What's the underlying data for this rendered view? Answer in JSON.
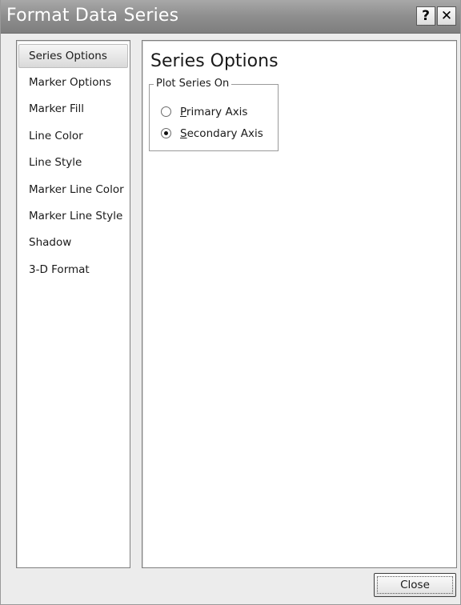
{
  "window": {
    "title": "Format Data Series",
    "help_label": "?",
    "close_label": "✕"
  },
  "sidebar": {
    "items": [
      {
        "label": "Series Options",
        "selected": true
      },
      {
        "label": "Marker Options",
        "selected": false
      },
      {
        "label": "Marker Fill",
        "selected": false
      },
      {
        "label": "Line Color",
        "selected": false
      },
      {
        "label": "Line Style",
        "selected": false
      },
      {
        "label": "Marker Line Color",
        "selected": false
      },
      {
        "label": "Marker Line Style",
        "selected": false
      },
      {
        "label": "Shadow",
        "selected": false
      },
      {
        "label": "3-D Format",
        "selected": false
      }
    ]
  },
  "main": {
    "title": "Series Options",
    "plot_series_group": {
      "legend": "Plot Series On",
      "options": [
        {
          "accel": "P",
          "rest": "rimary Axis",
          "checked": false
        },
        {
          "accel": "S",
          "rest": "econdary Axis",
          "checked": true
        }
      ]
    }
  },
  "footer": {
    "close_button": "Close"
  }
}
